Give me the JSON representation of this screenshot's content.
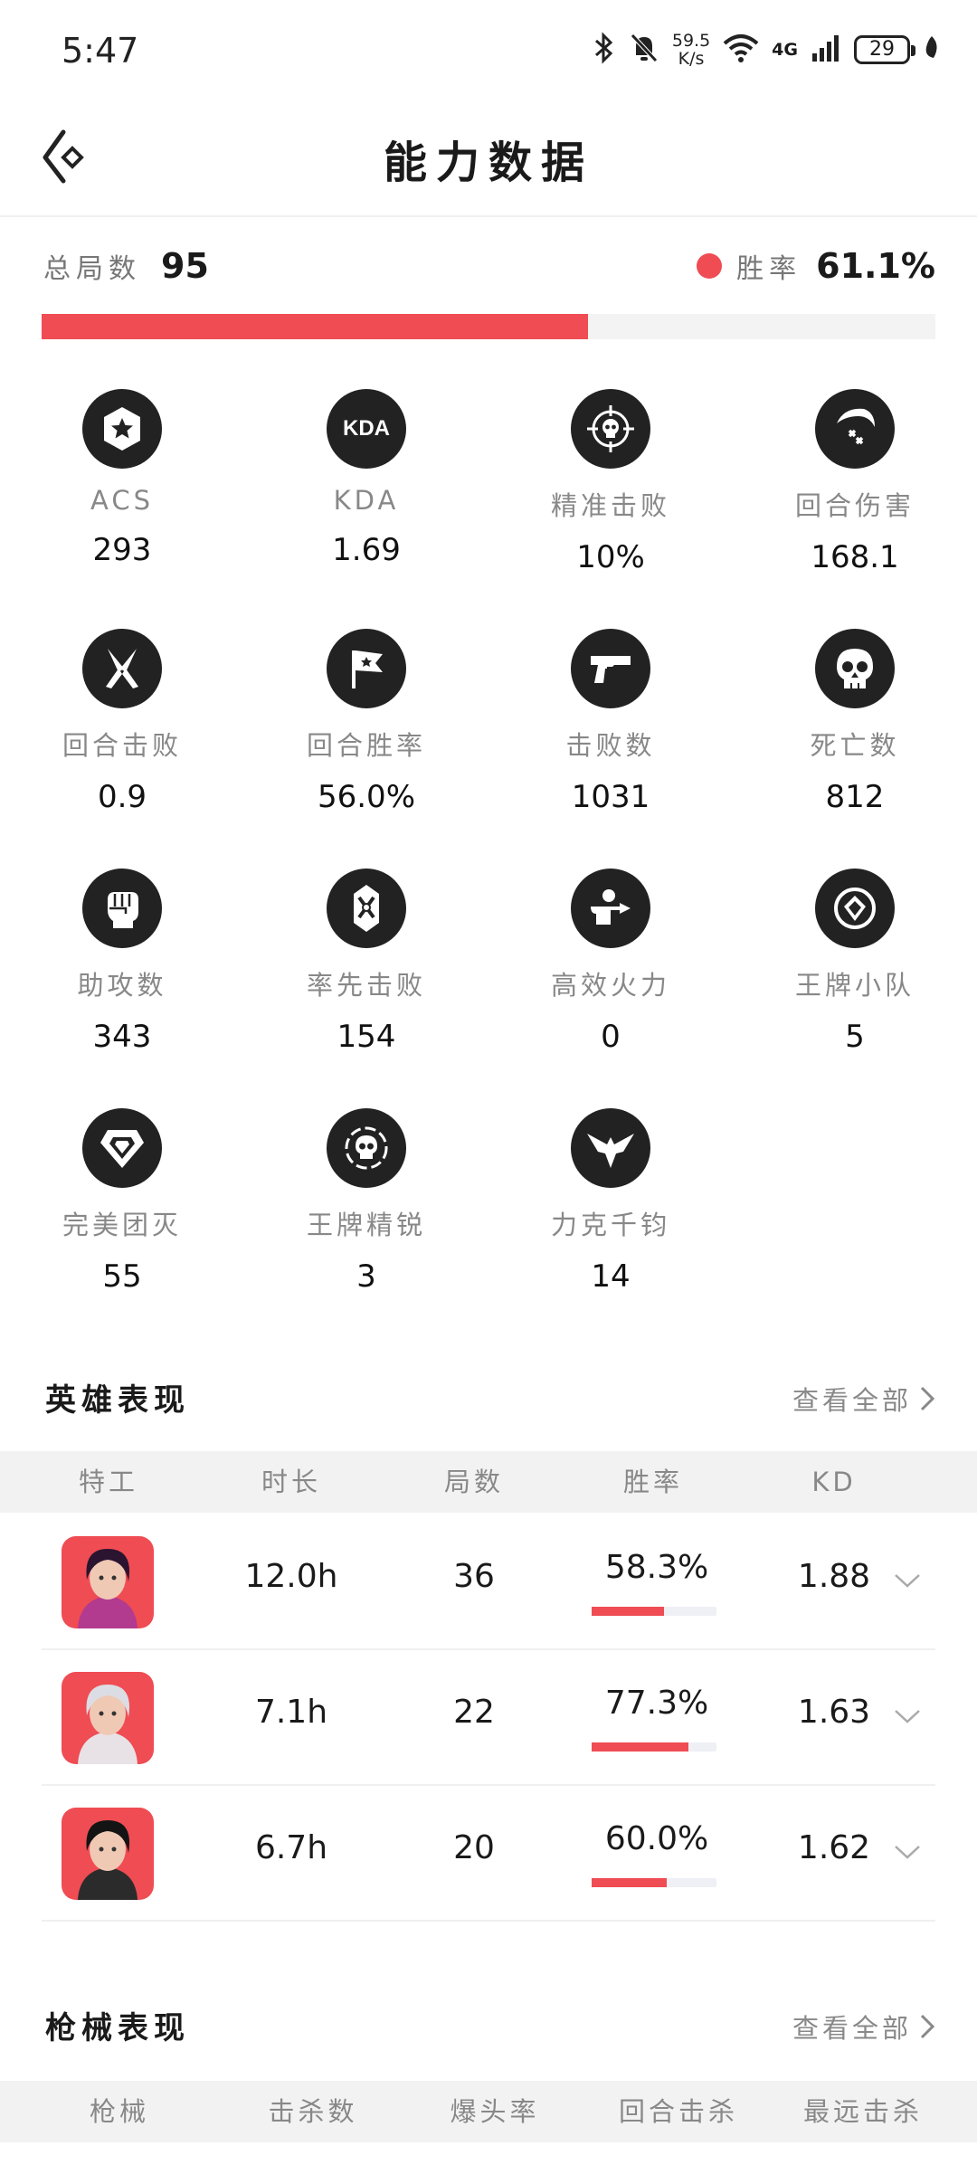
{
  "status_bar": {
    "time": "5:47",
    "net_speed_value": "59.5",
    "net_speed_unit": "K/s",
    "net_label": "4G",
    "battery": "29"
  },
  "header": {
    "title": "能力数据"
  },
  "summary": {
    "total_label": "总局数",
    "total_value": "95",
    "winrate_label": "胜率",
    "winrate_value": "61.1%",
    "winrate_fraction": 0.611
  },
  "stats": [
    {
      "icon": "star-badge-icon",
      "label": "ACS",
      "value": "293"
    },
    {
      "icon": "kda-icon",
      "icon_text": "KDA",
      "label": "KDA",
      "value": "1.69"
    },
    {
      "icon": "crosshair-skull-icon",
      "label": "精准击败",
      "value": "10%"
    },
    {
      "icon": "slash-damage-icon",
      "label": "回合伤害",
      "value": "168.1"
    },
    {
      "icon": "crossed-blades-icon",
      "label": "回合击败",
      "value": "0.9"
    },
    {
      "icon": "flag-icon",
      "label": "回合胜率",
      "value": "56.0%"
    },
    {
      "icon": "pistol-icon",
      "label": "击败数",
      "value": "1031"
    },
    {
      "icon": "skull-icon",
      "label": "死亡数",
      "value": "812"
    },
    {
      "icon": "fist-icon",
      "label": "助攻数",
      "value": "343"
    },
    {
      "icon": "first-blood-icon",
      "label": "率先击败",
      "value": "154"
    },
    {
      "icon": "firepower-icon",
      "label": "高效火力",
      "value": "0"
    },
    {
      "icon": "ace-squad-icon",
      "label": "王牌小队",
      "value": "5"
    },
    {
      "icon": "diamond-icon",
      "label": "完美团灭",
      "value": "55"
    },
    {
      "icon": "elite-skull-icon",
      "label": "王牌精锐",
      "value": "3"
    },
    {
      "icon": "eagle-icon",
      "label": "力克千钧",
      "value": "14"
    }
  ],
  "hero_section": {
    "title": "英雄表现",
    "view_all": "查看全部",
    "columns": [
      "特工",
      "时长",
      "局数",
      "胜率",
      "KD"
    ],
    "rows": [
      {
        "duration": "12.0h",
        "games": "36",
        "winrate": "58.3%",
        "winrate_fraction": 0.583,
        "kd": "1.88",
        "avatar_color": "#b23a8f"
      },
      {
        "duration": "7.1h",
        "games": "22",
        "winrate": "77.3%",
        "winrate_fraction": 0.773,
        "kd": "1.63",
        "avatar_color": "#e8e2e6"
      },
      {
        "duration": "6.7h",
        "games": "20",
        "winrate": "60.0%",
        "winrate_fraction": 0.6,
        "kd": "1.62",
        "avatar_color": "#2b2b2b"
      }
    ]
  },
  "weapon_section": {
    "title": "枪械表现",
    "view_all": "查看全部",
    "columns": [
      "枪械",
      "击杀数",
      "爆头率",
      "回合击杀",
      "最远击杀"
    ]
  },
  "colors": {
    "accent": "#ef4c53",
    "icon_bg": "#222222",
    "row_header_bg": "#f2f2f2"
  }
}
